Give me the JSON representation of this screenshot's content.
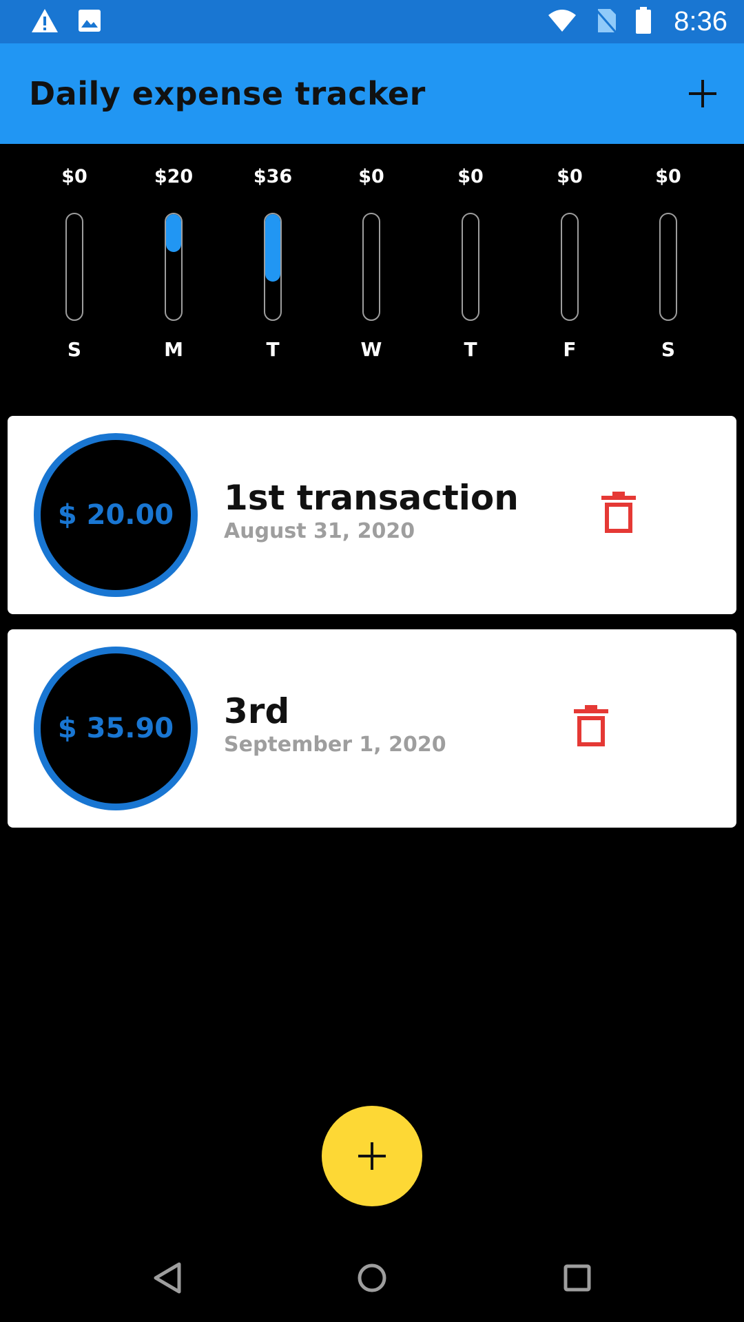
{
  "status_bar": {
    "time": "8:36",
    "left_icons": [
      "warning-icon",
      "image-icon"
    ],
    "right_icons": [
      "wifi-icon",
      "no-sim-icon",
      "battery-icon"
    ]
  },
  "app_bar": {
    "title": "Daily expense tracker",
    "action_icon": "add-icon"
  },
  "weekly_chart": {
    "days": [
      {
        "day": "S",
        "amount": "$0"
      },
      {
        "day": "M",
        "amount": "$20"
      },
      {
        "day": "T",
        "amount": "$36"
      },
      {
        "day": "W",
        "amount": "$0"
      },
      {
        "day": "T",
        "amount": "$0"
      },
      {
        "day": "F",
        "amount": "$0"
      },
      {
        "day": "S",
        "amount": "$0"
      }
    ],
    "fill_fractions": [
      0,
      0.36,
      0.64,
      0,
      0,
      0,
      0
    ],
    "fill_color": "#2196F3"
  },
  "transactions": [
    {
      "amount": "$ 20.00",
      "title": "1st transaction",
      "date": "August 31, 2020"
    },
    {
      "amount": "$ 35.90",
      "title": "3rd",
      "date": "September 1, 2020"
    }
  ],
  "colors": {
    "primary": "#2196F3",
    "status_bar": "#1976D2",
    "fab": "#FDD835",
    "delete": "#E53935"
  },
  "fab": {
    "icon": "add-icon"
  },
  "nav_bar": {
    "icons": [
      "back-icon",
      "home-icon",
      "recents-icon"
    ]
  }
}
